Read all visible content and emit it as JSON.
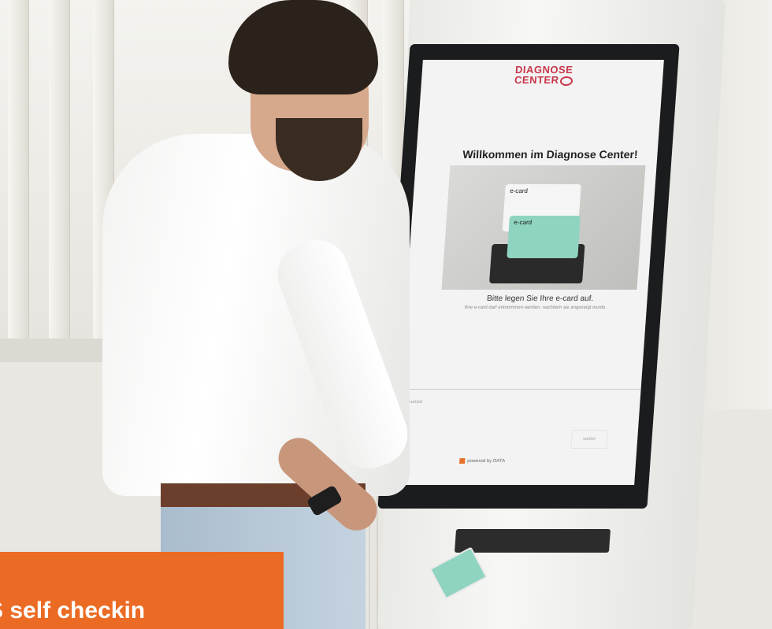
{
  "kiosk_screen": {
    "logo_line1": "DIAGNOSE",
    "logo_line2": "CENTER",
    "welcome": "Willkommen im Diagnose Center!",
    "ecard_label_back": "e-card",
    "ecard_label_front": "e-card",
    "instruction": "Bitte legen Sie Ihre e-card auf.",
    "instruction_small": "Ihre e-card darf entnommen werden, nachdem sie angezeigt wurde.",
    "back_button": "zurück",
    "next_button": "weiter",
    "footer_brand": "powered by",
    "footer_partner": "DATA"
  },
  "caption": {
    "text": "S self checkin"
  },
  "colors": {
    "caption_bg": "#ec6b24",
    "logo": "#c8364a",
    "ecard": "#8fd4c0"
  }
}
